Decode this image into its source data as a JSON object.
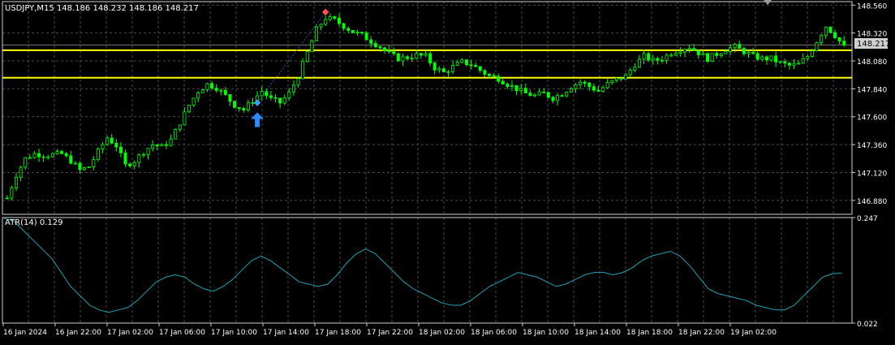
{
  "colors": {
    "background": "#000000",
    "grid": "#4a4a4a",
    "frame": "#cfcfcf",
    "candle_up": "#00ff00",
    "candle_down": "#00ff00",
    "level_line": "#ffff00",
    "price_line": "#7a7a7a",
    "atr_line": "#1fa3b4",
    "text": "#ffffff",
    "price_label_bg": "#cfcfcf",
    "price_label_text": "#000000",
    "buy_arrow": "#2a8cff",
    "trade_line": "#2a5aaa",
    "open_marker": "#3aa0ff",
    "close_marker": "#ff5050"
  },
  "main_header": "USDJPY,M15  148.186 148.232 148.186 148.217",
  "sub_header": "ATR(14) 0.129",
  "current_price_label": "148.217",
  "chart_data": [
    {
      "type": "candlestick",
      "symbol": "USDJPY",
      "timeframe": "M15",
      "ohlc_last": {
        "open": 148.186,
        "high": 148.232,
        "low": 148.186,
        "close": 148.217
      },
      "y_ticks": [
        "148.560",
        "148.320",
        "148.080",
        "147.840",
        "147.600",
        "147.360",
        "147.120",
        "146.880"
      ],
      "ylim": [
        146.76,
        148.59
      ],
      "horizontal_levels": [
        148.172,
        147.935
      ],
      "current_price": 148.217,
      "close_path": [
        [
          0,
          146.9
        ],
        [
          2,
          147.1
        ],
        [
          4,
          147.24
        ],
        [
          6,
          147.28
        ],
        [
          9,
          147.27
        ],
        [
          12,
          147.28
        ],
        [
          14,
          147.22
        ],
        [
          16,
          147.14
        ],
        [
          18,
          147.17
        ],
        [
          20,
          147.3
        ],
        [
          22,
          147.42
        ],
        [
          24,
          147.35
        ],
        [
          26,
          147.18
        ],
        [
          28,
          147.22
        ],
        [
          30,
          147.3
        ],
        [
          32,
          147.36
        ],
        [
          34,
          147.34
        ],
        [
          36,
          147.4
        ],
        [
          38,
          147.55
        ],
        [
          40,
          147.7
        ],
        [
          42,
          147.82
        ],
        [
          44,
          147.88
        ],
        [
          46,
          147.85
        ],
        [
          48,
          147.78
        ],
        [
          50,
          147.7
        ],
        [
          52,
          147.66
        ],
        [
          54,
          147.74
        ],
        [
          56,
          147.82
        ],
        [
          58,
          147.75
        ],
        [
          60,
          147.72
        ],
        [
          62,
          147.8
        ],
        [
          64,
          147.95
        ],
        [
          66,
          148.15
        ],
        [
          68,
          148.35
        ],
        [
          70,
          148.45
        ],
        [
          72,
          148.43
        ],
        [
          74,
          148.38
        ],
        [
          76,
          148.33
        ],
        [
          78,
          148.3
        ],
        [
          80,
          148.25
        ],
        [
          82,
          148.2
        ],
        [
          84,
          148.14
        ],
        [
          86,
          148.1
        ],
        [
          88,
          148.11
        ],
        [
          90,
          148.13
        ],
        [
          92,
          148.12
        ],
        [
          94,
          148.02
        ],
        [
          96,
          147.98
        ],
        [
          98,
          148.03
        ],
        [
          100,
          148.07
        ],
        [
          102,
          148.05
        ],
        [
          104,
          148.0
        ],
        [
          106,
          147.95
        ],
        [
          108,
          147.93
        ],
        [
          110,
          147.88
        ],
        [
          112,
          147.84
        ],
        [
          114,
          147.8
        ],
        [
          116,
          147.78
        ],
        [
          118,
          147.8
        ],
        [
          120,
          147.76
        ],
        [
          122,
          147.8
        ],
        [
          124,
          147.86
        ],
        [
          126,
          147.9
        ],
        [
          128,
          147.86
        ],
        [
          130,
          147.82
        ],
        [
          132,
          147.88
        ],
        [
          134,
          147.92
        ],
        [
          136,
          147.95
        ],
        [
          138,
          148.05
        ],
        [
          140,
          148.12
        ],
        [
          142,
          148.08
        ],
        [
          144,
          148.1
        ],
        [
          146,
          148.15
        ],
        [
          148,
          148.18
        ],
        [
          150,
          148.2
        ],
        [
          152,
          148.15
        ],
        [
          154,
          148.1
        ],
        [
          156,
          148.14
        ],
        [
          158,
          148.18
        ],
        [
          160,
          148.2
        ],
        [
          162,
          148.16
        ],
        [
          164,
          148.12
        ],
        [
          166,
          148.1
        ],
        [
          168,
          148.1
        ],
        [
          170,
          148.06
        ],
        [
          172,
          148.04
        ],
        [
          174,
          148.05
        ],
        [
          176,
          148.12
        ],
        [
          178,
          148.25
        ],
        [
          180,
          148.38
        ],
        [
          182,
          148.3
        ],
        [
          184,
          148.2
        ]
      ],
      "trade": {
        "direction": "buy",
        "open_price": 147.72,
        "close_price": 148.5
      },
      "x_tick_labels": [
        "16 Jan 2024",
        "16 Jan 22:00",
        "17 Jan 02:00",
        "17 Jan 06:00",
        "17 Jan 10:00",
        "17 Jan 14:00",
        "17 Jan 18:00",
        "17 Jan 22:00",
        "18 Jan 02:00",
        "18 Jan 06:00",
        "18 Jan 10:00",
        "18 Jan 14:00",
        "18 Jan 18:00",
        "18 Jan 22:00",
        "19 Jan 02:00"
      ],
      "grid": true
    },
    {
      "type": "line",
      "name": "ATR(14)",
      "last_value": 0.129,
      "y_ticks": [
        "0.247",
        "0.022"
      ],
      "ylim": [
        0.022,
        0.247
      ],
      "values": [
        0.245,
        0.24,
        0.22,
        0.2,
        0.18,
        0.16,
        0.13,
        0.1,
        0.08,
        0.06,
        0.05,
        0.045,
        0.05,
        0.055,
        0.07,
        0.09,
        0.11,
        0.12,
        0.125,
        0.12,
        0.105,
        0.095,
        0.09,
        0.1,
        0.115,
        0.135,
        0.155,
        0.165,
        0.155,
        0.14,
        0.125,
        0.11,
        0.105,
        0.1,
        0.105,
        0.125,
        0.15,
        0.17,
        0.18,
        0.17,
        0.15,
        0.13,
        0.11,
        0.095,
        0.085,
        0.075,
        0.065,
        0.06,
        0.06,
        0.07,
        0.085,
        0.1,
        0.11,
        0.12,
        0.13,
        0.125,
        0.12,
        0.11,
        0.1,
        0.105,
        0.115,
        0.125,
        0.13,
        0.13,
        0.125,
        0.13,
        0.14,
        0.155,
        0.165,
        0.17,
        0.175,
        0.165,
        0.145,
        0.12,
        0.095,
        0.085,
        0.08,
        0.075,
        0.07,
        0.06,
        0.055,
        0.05,
        0.05,
        0.06,
        0.08,
        0.1,
        0.12,
        0.127,
        0.129
      ]
    }
  ]
}
